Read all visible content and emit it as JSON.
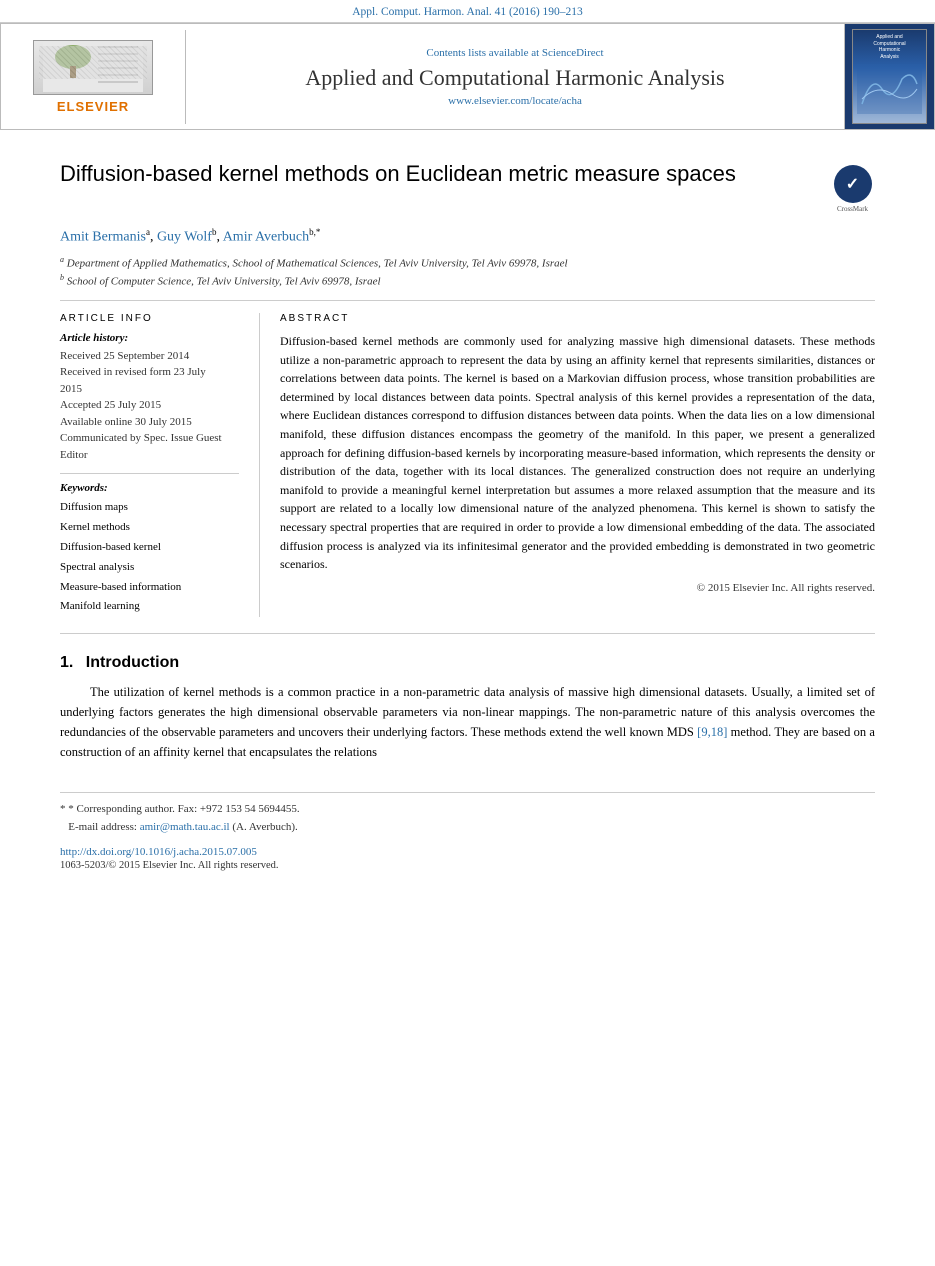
{
  "journal_ref_bar": {
    "text": "Appl. Comput. Harmon. Anal. 41 (2016) 190–213"
  },
  "header": {
    "contents_label": "Contents lists available at",
    "sciencedirect": "ScienceDirect",
    "journal_title": "Applied and Computational Harmonic Analysis",
    "journal_url": "www.elsevier.com/locate/acha",
    "elsevier_text": "ELSEVIER"
  },
  "paper": {
    "title": "Diffusion-based kernel methods on Euclidean metric measure spaces",
    "crossmark_label": "CrossMark",
    "authors": {
      "list": "Amit Bermanis",
      "a_sup": "a",
      "author2": ", Guy Wolf",
      "b_sup": "b",
      "author3": ", Amir Averbuch",
      "b_star_sup": "b,*"
    },
    "affiliations": [
      {
        "sup": "a",
        "text": "Department of Applied Mathematics, School of Mathematical Sciences, Tel Aviv University, Tel Aviv 69978, Israel"
      },
      {
        "sup": "b",
        "text": "School of Computer Science, Tel Aviv University, Tel Aviv 69978, Israel"
      }
    ]
  },
  "article_info": {
    "header": "ARTICLE  INFO",
    "history_label": "Article history:",
    "history_items": [
      "Received 25 September 2014",
      "Received in revised form 23 July 2015",
      "Accepted 25 July 2015",
      "Available online 30 July 2015",
      "Communicated by Spec. Issue Guest Editor"
    ],
    "keywords_label": "Keywords:",
    "keywords": [
      "Diffusion maps",
      "Kernel methods",
      "Diffusion-based kernel",
      "Spectral analysis",
      "Measure-based information",
      "Manifold learning"
    ]
  },
  "abstract": {
    "header": "ABSTRACT",
    "text": "Diffusion-based kernel methods are commonly used for analyzing massive high dimensional datasets. These methods utilize a non-parametric approach to represent the data by using an affinity kernel that represents similarities, distances or correlations between data points. The kernel is based on a Markovian diffusion process, whose transition probabilities are determined by local distances between data points. Spectral analysis of this kernel provides a representation of the data, where Euclidean distances correspond to diffusion distances between data points. When the data lies on a low dimensional manifold, these diffusion distances encompass the geometry of the manifold. In this paper, we present a generalized approach for defining diffusion-based kernels by incorporating measure-based information, which represents the density or distribution of the data, together with its local distances. The generalized construction does not require an underlying manifold to provide a meaningful kernel interpretation but assumes a more relaxed assumption that the measure and its support are related to a locally low dimensional nature of the analyzed phenomena. This kernel is shown to satisfy the necessary spectral properties that are required in order to provide a low dimensional embedding of the data. The associated diffusion process is analyzed via its infinitesimal generator and the provided embedding is demonstrated in two geometric scenarios.",
    "copyright": "© 2015 Elsevier Inc. All rights reserved."
  },
  "introduction": {
    "number": "1.",
    "title": "Introduction",
    "text": "The utilization of kernel methods is a common practice in a non-parametric data analysis of massive high dimensional datasets. Usually, a limited set of underlying factors generates the high dimensional observable parameters via non-linear mappings. The non-parametric nature of this analysis overcomes the redundancies of the observable parameters and uncovers their underlying factors. These methods extend the well known MDS [9,18] method. They are based on a construction of an affinity kernel that encapsulates the relations"
  },
  "footnote": {
    "star_note": "* Corresponding author. Fax: +972 153 54 5694455.",
    "email_label": "E-mail address:",
    "email": "amir@math.tau.ac.il",
    "email_suffix": " (A. Averbuch)."
  },
  "doi": {
    "text": "http://dx.doi.org/10.1016/j.acha.2015.07.005"
  },
  "issn": {
    "text": "1063-5203/© 2015 Elsevier Inc. All rights reserved."
  },
  "citations": {
    "mds": "[9,18]"
  }
}
